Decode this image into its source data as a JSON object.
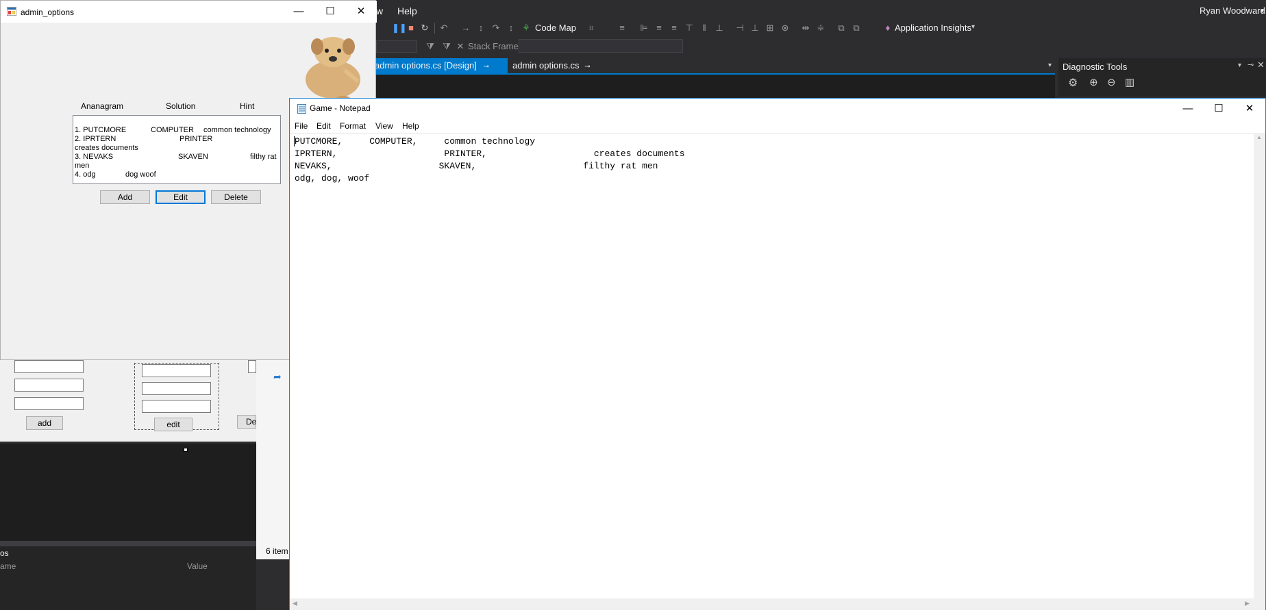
{
  "vs": {
    "menu_help": "Help",
    "menu_view_partial": "w",
    "user": "Ryan Woodward",
    "code_map": "Code Map",
    "app_insights": "Application Insights",
    "stack_frame": "Stack Frame:",
    "tab_design": "admin options.cs [Design]",
    "tab_code": "admin options.cs",
    "diag_title": "Diagnostic Tools",
    "form_add": "add",
    "form_edit": "edit",
    "form_del": "Del",
    "sol_count": "6 item",
    "props_name": "ame",
    "props_value": "Value",
    "props_cut": "os"
  },
  "admin": {
    "title": "admin_options",
    "headers": [
      "Ananagram",
      "Solution",
      "Hint"
    ],
    "list": [
      {
        "a": "1. PUTCMORE",
        "b": "COMPUTER",
        "c": "common technology"
      },
      {
        "a": "2. IPRTERN",
        "b": "PRINTER",
        "c": ""
      },
      {
        "a": "creates documents",
        "b": "",
        "c": ""
      },
      {
        "a": "3. NEVAKS",
        "b": "SKAVEN",
        "c": "filthy rat"
      },
      {
        "a": "men",
        "b": "",
        "c": ""
      },
      {
        "a": "4. odg",
        "b": "dog woof",
        "c": ""
      }
    ],
    "add": "Add",
    "edit": "Edit",
    "delete": "Delete"
  },
  "notepad": {
    "title": "Game - Notepad",
    "menu": [
      "File",
      "Edit",
      "Format",
      "View",
      "Help"
    ],
    "lines": [
      "PUTCMORE,     COMPUTER,     common technology",
      "IPRTERN,                    PRINTER,                    creates documents",
      "NEVAKS,                    SKAVEN,                    filthy rat men",
      "odg, dog, woof"
    ]
  }
}
